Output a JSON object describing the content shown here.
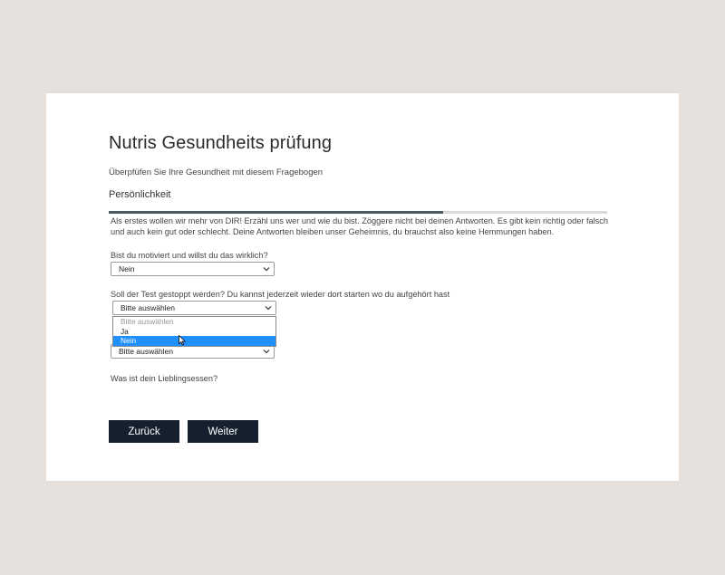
{
  "form": {
    "title": "Nutris Gesundheits prüfung",
    "subtitle": "Überpfüfen Sie Ihre Gesundheit mit diesem Fragebogen",
    "section": "Persönlichkeit",
    "progress": 0.67,
    "intro": "Als erstes wollen wir mehr von DIR! Erzähl uns wer und wie du bist. Zöggere nicht bei deinen Antworten. Es gibt kein richtig oder falsch und auch kein gut oder schlecht. Deine Antworten bleiben unser Geheimnis, du brauchst also keine Hemmungen haben."
  },
  "questions": {
    "q1": {
      "label": "Bist du motiviert und willst du das wirklich?",
      "value": "Nein"
    },
    "q2": {
      "label": "Soll der Test gestoppt werden? Du kannst jederzeit wieder dort starten wo du aufgehört hast",
      "value": "Bitte auswählen",
      "options": [
        "Bitte auswählen",
        "Ja",
        "Nein"
      ],
      "highlighted": "Nein"
    },
    "q3": {
      "value": "Bitte auswählen"
    },
    "q4": {
      "label": "Was ist dein Lieblingsessen?"
    }
  },
  "buttons": {
    "back": "Zurück",
    "next": "Weiter"
  },
  "colors": {
    "background": "#e5e0dc",
    "button": "#14202e",
    "highlight": "#1e90ff",
    "progress": "#4a5a63"
  }
}
